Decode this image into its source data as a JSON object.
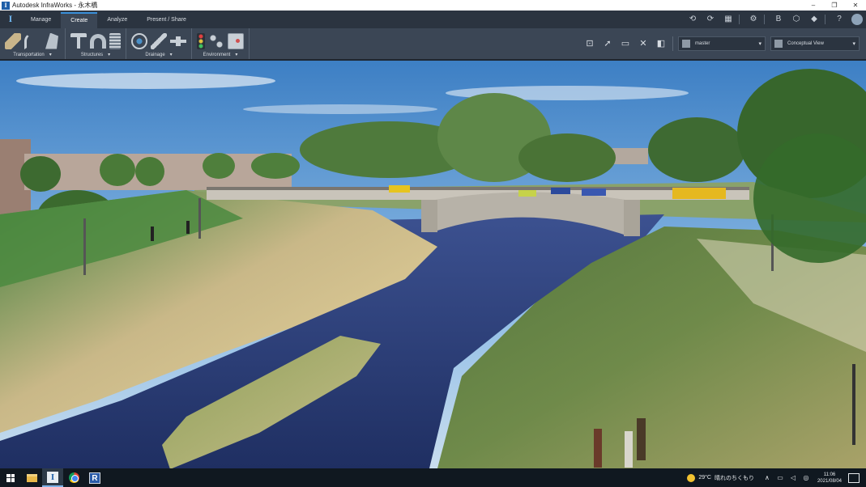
{
  "window": {
    "title": "Autodesk InfraWorks - 永木橋",
    "minimize_glyph": "–",
    "restore_glyph": "❐",
    "close_glyph": "✕"
  },
  "tabs": [
    {
      "label": "Manage",
      "active": false
    },
    {
      "label": "Create",
      "active": true
    },
    {
      "label": "Analyze",
      "active": false
    },
    {
      "label": "Present / Share",
      "active": false
    }
  ],
  "ribbon": {
    "groups": {
      "transportation": "Transportation",
      "structures": "Structures",
      "drainage": "Drainage",
      "environment": "Environment"
    },
    "caret": "▾",
    "proposal_dropdown": "master",
    "view_dropdown": "Conceptual View"
  },
  "taskbar": {
    "weather_temp": "29°C",
    "weather_desc": "晴れのちくもり",
    "time": "11:06",
    "date": "2021/08/04"
  },
  "colors": {
    "accent": "#3a8fd9",
    "ribbon_bg": "#3b4655",
    "tabbar_bg": "#2b3440",
    "river": "#2a3e78",
    "sky_top": "#3d7fc4"
  }
}
